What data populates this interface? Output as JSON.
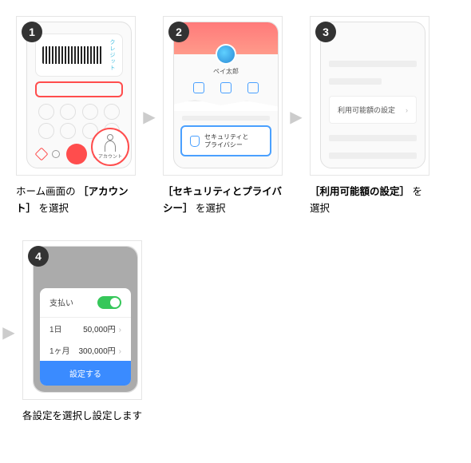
{
  "steps": [
    {
      "num": "1",
      "caption_pre": "ホーム画面の ",
      "caption_bold": "［アカウント］",
      "caption_post": " を選択"
    },
    {
      "num": "2",
      "caption_pre": "",
      "caption_bold": "［セキュリティとプライバシー］",
      "caption_post": " を選択"
    },
    {
      "num": "3",
      "caption_pre": "",
      "caption_bold": "［利用可能額の設定］",
      "caption_post": " を選択"
    },
    {
      "num": "4",
      "caption_pre": "各設定を選択し設定します",
      "caption_bold": "",
      "caption_post": ""
    }
  ],
  "s1": {
    "credit": "クレジット",
    "account": "アカウント"
  },
  "s2": {
    "name": "ペイ太郎",
    "security": "セキュリティと\nプライバシー"
  },
  "s3": {
    "label": "利用可能額の設定"
  },
  "s4": {
    "pay_label": "支払い",
    "rows": [
      {
        "period": "1日",
        "amount": "50,000円"
      },
      {
        "period": "1ヶ月",
        "amount": "300,000円"
      }
    ],
    "button": "設定する"
  }
}
